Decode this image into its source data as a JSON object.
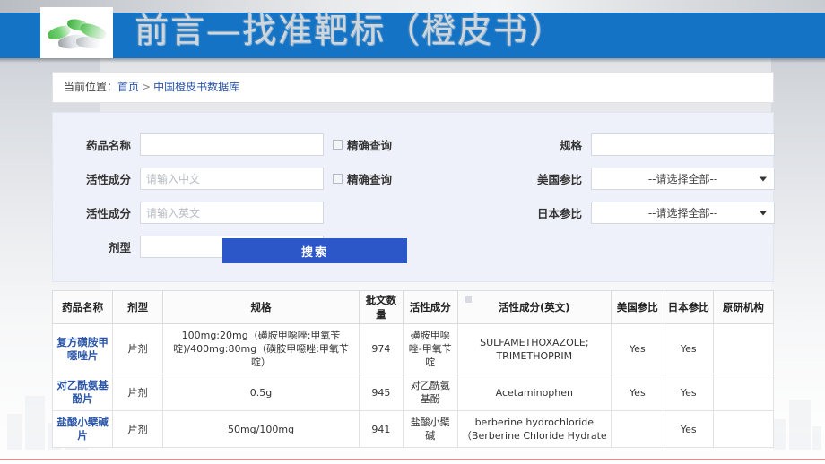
{
  "slide": {
    "title": "前言—找准靶标（橙皮书）",
    "logo_alt": "capsules-logo"
  },
  "breadcrumb": {
    "label": "当前位置：",
    "home": "首页",
    "separator": ">",
    "current": "中国橙皮书数据库"
  },
  "search_form": {
    "drug_name": {
      "label": "药品名称",
      "value": "",
      "placeholder": ""
    },
    "exact_1": {
      "label": "精确查询",
      "checked": false
    },
    "ingredient_cn": {
      "label": "活性成分",
      "value": "",
      "placeholder": "请输入中文"
    },
    "exact_2": {
      "label": "精确查询",
      "checked": false
    },
    "ingredient_en": {
      "label": "活性成分",
      "value": "",
      "placeholder": "请输入英文"
    },
    "dosage_form": {
      "label": "剂型",
      "value": "",
      "placeholder": ""
    },
    "spec": {
      "label": "规格",
      "value": "",
      "placeholder": ""
    },
    "us_ref": {
      "label": "美国参比",
      "selected": "--请选择全部--"
    },
    "jp_ref": {
      "label": "日本参比",
      "selected": "--请选择全部--"
    },
    "submit": "搜索"
  },
  "results_table": {
    "headers": [
      "药品名称",
      "剂型",
      "规格",
      "批文数量",
      "活性成分",
      "活性成分(英文)",
      "美国参比",
      "日本参比",
      "原研机构"
    ],
    "rows": [
      {
        "name": "复方磺胺甲噁唑片",
        "form": "片剂",
        "spec": "100mg:20mg（磺胺甲噁唑:甲氧苄啶)/400mg:80mg（磺胺甲噁唑:甲氧苄啶）",
        "count": "974",
        "ingredient_cn": "磺胺甲噁唑-甲氧苄啶",
        "ingredient_en": "SULFAMETHOXAZOLE; TRIMETHOPRIM",
        "us_ref": "Yes",
        "jp_ref": "Yes",
        "originator": ""
      },
      {
        "name": "对乙酰氨基酚片",
        "form": "片剂",
        "spec": "0.5g",
        "count": "945",
        "ingredient_cn": "对乙酰氨基酚",
        "ingredient_en": "Acetaminophen",
        "us_ref": "Yes",
        "jp_ref": "Yes",
        "originator": ""
      },
      {
        "name": "盐酸小檗碱片",
        "form": "片剂",
        "spec": "50mg/100mg",
        "count": "941",
        "ingredient_cn": "盐酸小檗碱",
        "ingredient_en": "berberine hydrochloride（Berberine Chloride Hydrate",
        "us_ref": "",
        "jp_ref": "Yes",
        "originator": ""
      }
    ]
  },
  "colors": {
    "header_blue": "#1473c4",
    "button_blue": "#2b57c9",
    "link_blue": "#2a55a8",
    "form_bg": "#eef1f9",
    "rule_red": "#d06a6a"
  }
}
